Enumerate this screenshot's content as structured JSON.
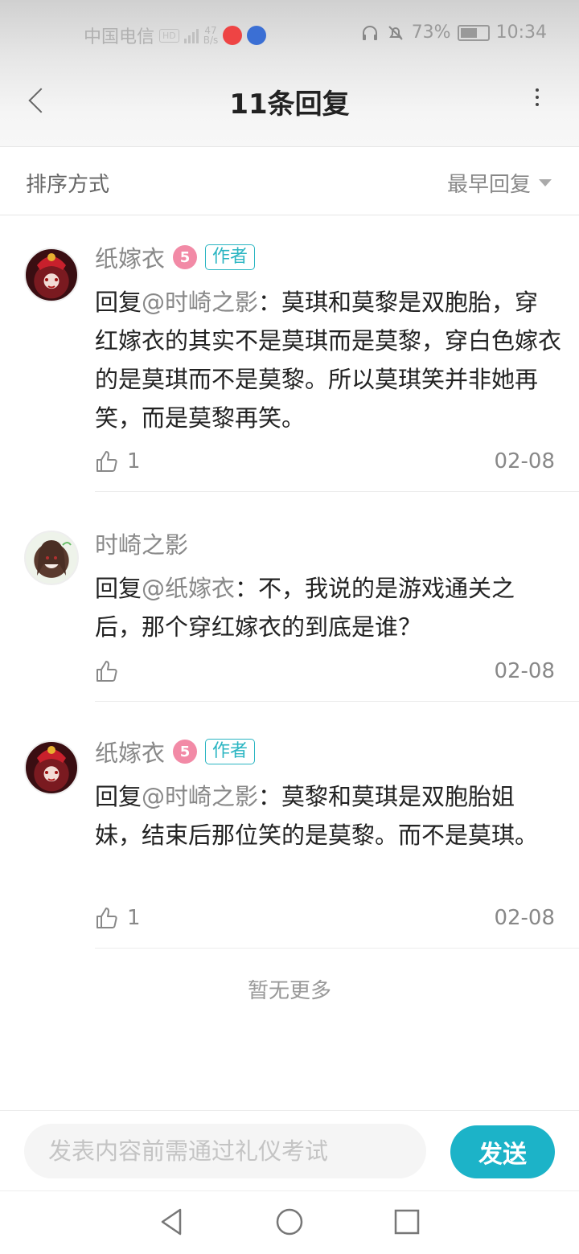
{
  "status_bar": {
    "carrier": "中国电信",
    "hd": "HD",
    "network": "4G",
    "speed_value": "47",
    "speed_unit": "B/s",
    "battery_percent": "73%",
    "time": "10:34"
  },
  "header": {
    "title": "11条回复"
  },
  "sort": {
    "label": "排序方式",
    "selected": "最早回复"
  },
  "comments": [
    {
      "username": "纸嫁衣",
      "level": "5",
      "tag": "作者",
      "reply_prefix": "回复",
      "mention": "@时崎之影",
      "text": "：莫琪和莫黎是双胞胎，穿红嫁衣的其实不是莫琪而是莫黎，穿白色嫁衣的是莫琪而不是莫黎。所以莫琪笑并非她再笑，而是莫黎再笑。",
      "likes": "1",
      "date": "02-08"
    },
    {
      "username": "时崎之影",
      "level": "",
      "tag": "",
      "reply_prefix": "回复",
      "mention": "@纸嫁衣",
      "text": "：不，我说的是游戏通关之后，那个穿红嫁衣的到底是谁？",
      "likes": "",
      "date": "02-08"
    },
    {
      "username": "纸嫁衣",
      "level": "5",
      "tag": "作者",
      "reply_prefix": "回复",
      "mention": "@时崎之影",
      "text": "：莫黎和莫琪是双胞胎姐妹，结束后那位笑的是莫黎。而不是莫琪。",
      "likes": "1",
      "date": "02-08"
    }
  ],
  "footer": {
    "no_more": "暂无更多",
    "input_placeholder": "发表内容前需通过礼仪考试",
    "send_label": "发送"
  },
  "colors": {
    "accent": "#1cb3c8",
    "author_tag": "#2ab5c2",
    "level_badge": "#f28aa6"
  }
}
